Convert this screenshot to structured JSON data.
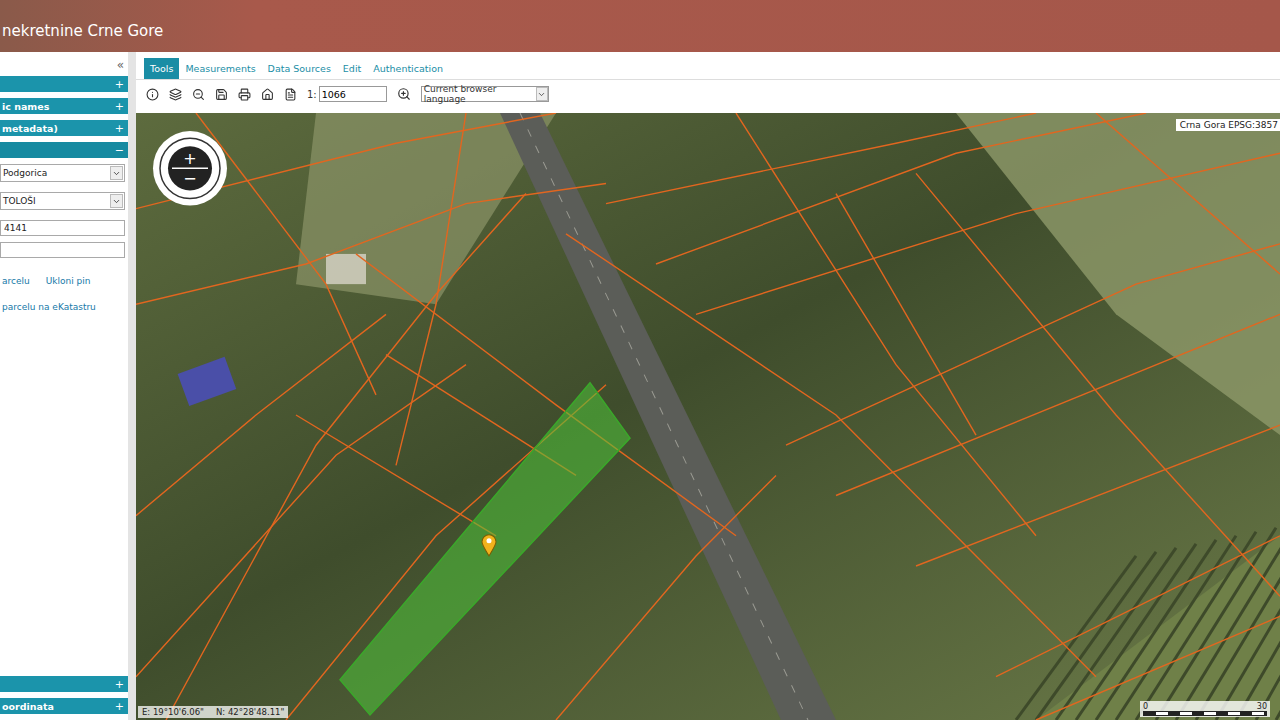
{
  "header": {
    "title": "nekretnine Crne Gore"
  },
  "sidebar": {
    "collapse": "«",
    "sections_top": [
      {
        "label": "",
        "toggle": "+",
        "expanded": false
      },
      {
        "label": "ic names",
        "toggle": "+",
        "expanded": false
      },
      {
        "label": "metadata)",
        "toggle": "+",
        "expanded": false
      },
      {
        "label": "",
        "toggle": "−",
        "expanded": true
      }
    ],
    "selects": [
      {
        "value": "Podgorica"
      },
      {
        "value": "TOLOŠI"
      }
    ],
    "inputs": [
      {
        "value": "4141"
      },
      {
        "value": ""
      }
    ],
    "links": [
      "arcelu",
      "Ukloni pin"
    ],
    "link_ekatastar": "parcelu na eKatastru",
    "sections_bottom": [
      {
        "label": "",
        "toggle": "+",
        "expanded": false
      },
      {
        "label": "oordinata",
        "toggle": "+",
        "expanded": false
      }
    ]
  },
  "tabs": [
    {
      "label": "Tools",
      "selected": true
    },
    {
      "label": "Measurements",
      "selected": false
    },
    {
      "label": "Data Sources",
      "selected": false
    },
    {
      "label": "Edit",
      "selected": false
    },
    {
      "label": "Authentication",
      "selected": false
    }
  ],
  "toolbar": {
    "scale_prefix": "1:",
    "scale": "1066",
    "language": "Current browser language"
  },
  "map": {
    "zoom_in": "+",
    "zoom_out": "−",
    "crs": "Crna Gora EPSG:3857",
    "coord_e": "E: 19°10'6.06\"",
    "coord_n": "N: 42°28'48.11\"",
    "scale_start": "0",
    "scale_end": "30"
  }
}
